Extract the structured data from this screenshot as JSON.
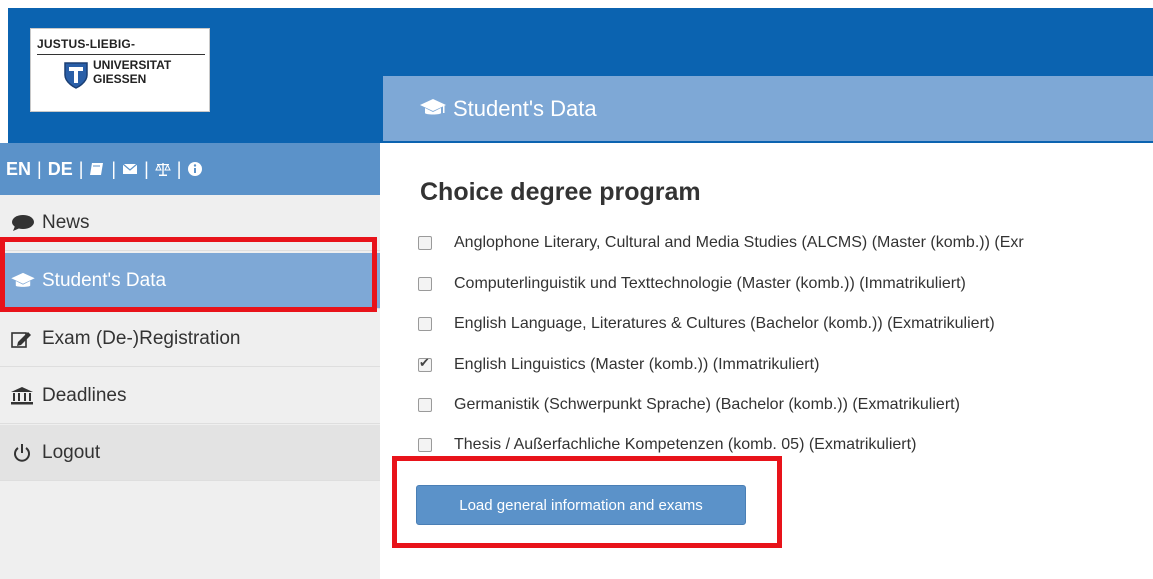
{
  "logo": {
    "line1": "JUSTUS-LIEBIG-",
    "line2": "UNIVERSITAT",
    "line3": "GIESSEN"
  },
  "header": {
    "title": "Student's Data",
    "icon": "graduation-cap-icon"
  },
  "langbar": {
    "en": "EN",
    "de": "DE",
    "separator": "|",
    "icons": [
      "book-icon",
      "envelope-icon",
      "scale-icon",
      "info-icon"
    ]
  },
  "sidebar": {
    "items": [
      {
        "label": "News",
        "icon": "comment-icon"
      },
      {
        "label": "Student's Data",
        "icon": "graduation-cap-icon",
        "active": true
      },
      {
        "label": "Exam (De-)Registration",
        "icon": "edit-icon"
      },
      {
        "label": "Deadlines",
        "icon": "bank-icon"
      },
      {
        "label": "Logout",
        "icon": "power-icon"
      }
    ]
  },
  "main": {
    "title": "Choice degree program",
    "programs": [
      {
        "label": "Anglophone Literary, Cultural and Media Studies (ALCMS) (Master (komb.)) (Exr",
        "checked": false
      },
      {
        "label": "Computerlinguistik und Texttechnologie (Master (komb.)) (Immatrikuliert)",
        "checked": false
      },
      {
        "label": "English Language, Literatures & Cultures (Bachelor (komb.)) (Exmatrikuliert)",
        "checked": false
      },
      {
        "label": "English Linguistics (Master (komb.)) (Immatrikuliert)",
        "checked": true
      },
      {
        "label": "Germanistik (Schwerpunkt Sprache) (Bachelor (komb.)) (Exmatrikuliert)",
        "checked": false
      },
      {
        "label": "Thesis / Außerfachliche Kompetenzen (komb. 05) (Exmatrikuliert)",
        "checked": false
      }
    ],
    "button_label": "Load general information and exams"
  },
  "colors": {
    "topbar": "#0b63b0",
    "header": "#7ea8d6",
    "langbar": "#5b92c9",
    "highlight": "#e8131a"
  }
}
